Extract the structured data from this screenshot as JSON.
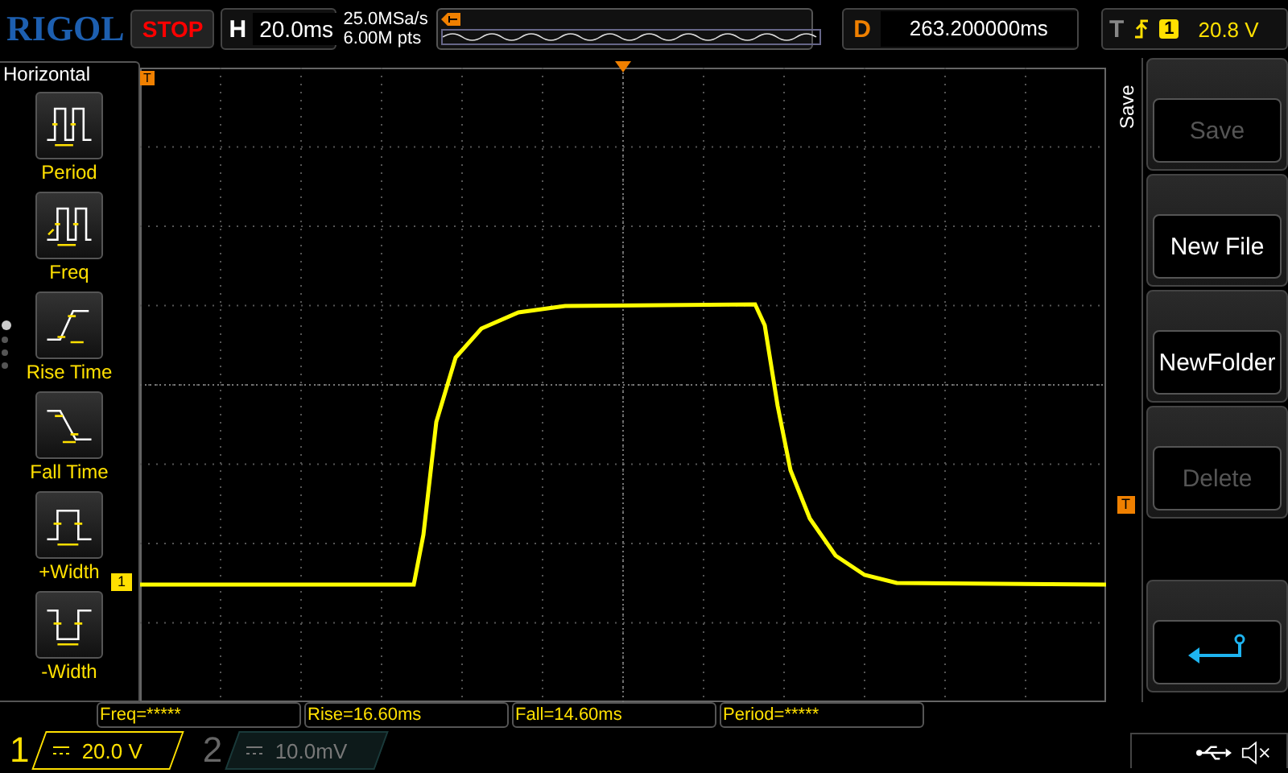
{
  "logo": "RIGOL",
  "run_state": "STOP",
  "timebase": {
    "label": "H",
    "value": "20.0ms"
  },
  "sample_rate": "25.0MSa/s",
  "memory_depth": "6.00M pts",
  "delay": {
    "label": "D",
    "value": "263.200000ms"
  },
  "trigger": {
    "label": "T",
    "channel": "1",
    "level": "20.8 V"
  },
  "measure_menu": {
    "title": "Horizontal",
    "items": [
      {
        "label": "Period",
        "kind": "period"
      },
      {
        "label": "Freq",
        "kind": "freq"
      },
      {
        "label": "Rise Time",
        "kind": "rise"
      },
      {
        "label": "Fall Time",
        "kind": "fall"
      },
      {
        "label": "+Width",
        "kind": "pwidth"
      },
      {
        "label": "-Width",
        "kind": "nwidth"
      }
    ],
    "pages": [
      {
        "selected": true
      },
      {
        "selected": false
      },
      {
        "selected": false
      },
      {
        "selected": false
      }
    ]
  },
  "scope": {
    "channel_marker": "1",
    "trigger_position_marker": "T",
    "trigger_level_marker": "T"
  },
  "menu": {
    "title": "Save",
    "buttons": [
      {
        "kind": "text",
        "label": "Save",
        "disabled": true
      },
      {
        "kind": "text",
        "label": "New File",
        "disabled": false
      },
      {
        "kind": "text",
        "label": "NewFolder",
        "disabled": false
      },
      {
        "kind": "text",
        "label": "Delete",
        "disabled": true
      },
      {
        "kind": "back"
      }
    ]
  },
  "measurements": [
    "Freq=*****",
    "Rise=16.60ms",
    "Fall=14.60ms",
    "Period=*****"
  ],
  "channels": [
    {
      "number": "1",
      "scale": "20.0 V",
      "on": true
    },
    {
      "number": "2",
      "scale": "10.0mV",
      "on": false
    }
  ]
}
